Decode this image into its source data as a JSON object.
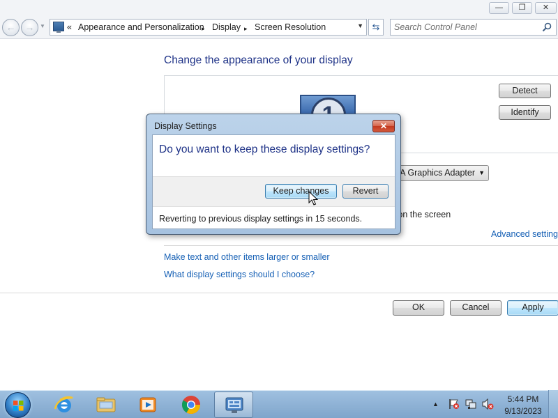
{
  "window": {
    "minimize_glyph": "—",
    "maximize_glyph": "❐",
    "close_glyph": "✕"
  },
  "nav": {
    "back_glyph": "←",
    "forward_glyph": "→",
    "breadcrumb_prefix": "«",
    "breadcrumbs": [
      "Appearance and Personalization",
      "Display",
      "Screen Resolution"
    ],
    "separator": "▸",
    "address_dropdown_glyph": "▼",
    "refresh_glyph": "⇆",
    "search_placeholder": "Search Control Panel"
  },
  "main": {
    "heading": "Change the appearance of your display",
    "monitor_number": "1",
    "detect_label": "Detect",
    "identify_label": "Identify",
    "display_select_value": "SA Graphics Adapter",
    "orientation_text_fragment": "t on the screen.",
    "advanced_link": "Advanced settings",
    "link_text_size": "Make text and other items larger or smaller",
    "link_which_settings": "What display settings should I choose?",
    "ok_label": "OK",
    "cancel_label": "Cancel",
    "apply_label": "Apply"
  },
  "dialog": {
    "title": "Display Settings",
    "close_glyph": "✕",
    "question": "Do you want to keep these display settings?",
    "keep_label": "Keep changes",
    "revert_label": "Revert",
    "countdown_text": "Reverting to previous display settings in 15 seconds."
  },
  "taskbar": {
    "items": [
      "internet-explorer-icon",
      "windows-explorer-icon",
      "media-player-icon",
      "chrome-icon",
      "control-panel-icon"
    ],
    "time": "5:44 PM",
    "date": "9/13/2023"
  },
  "colors": {
    "heading_blue": "#1e3287",
    "link_blue": "#1660b5",
    "taskbar_top": "#9fc0e0",
    "dialog_frame": "#a6c2e0"
  }
}
